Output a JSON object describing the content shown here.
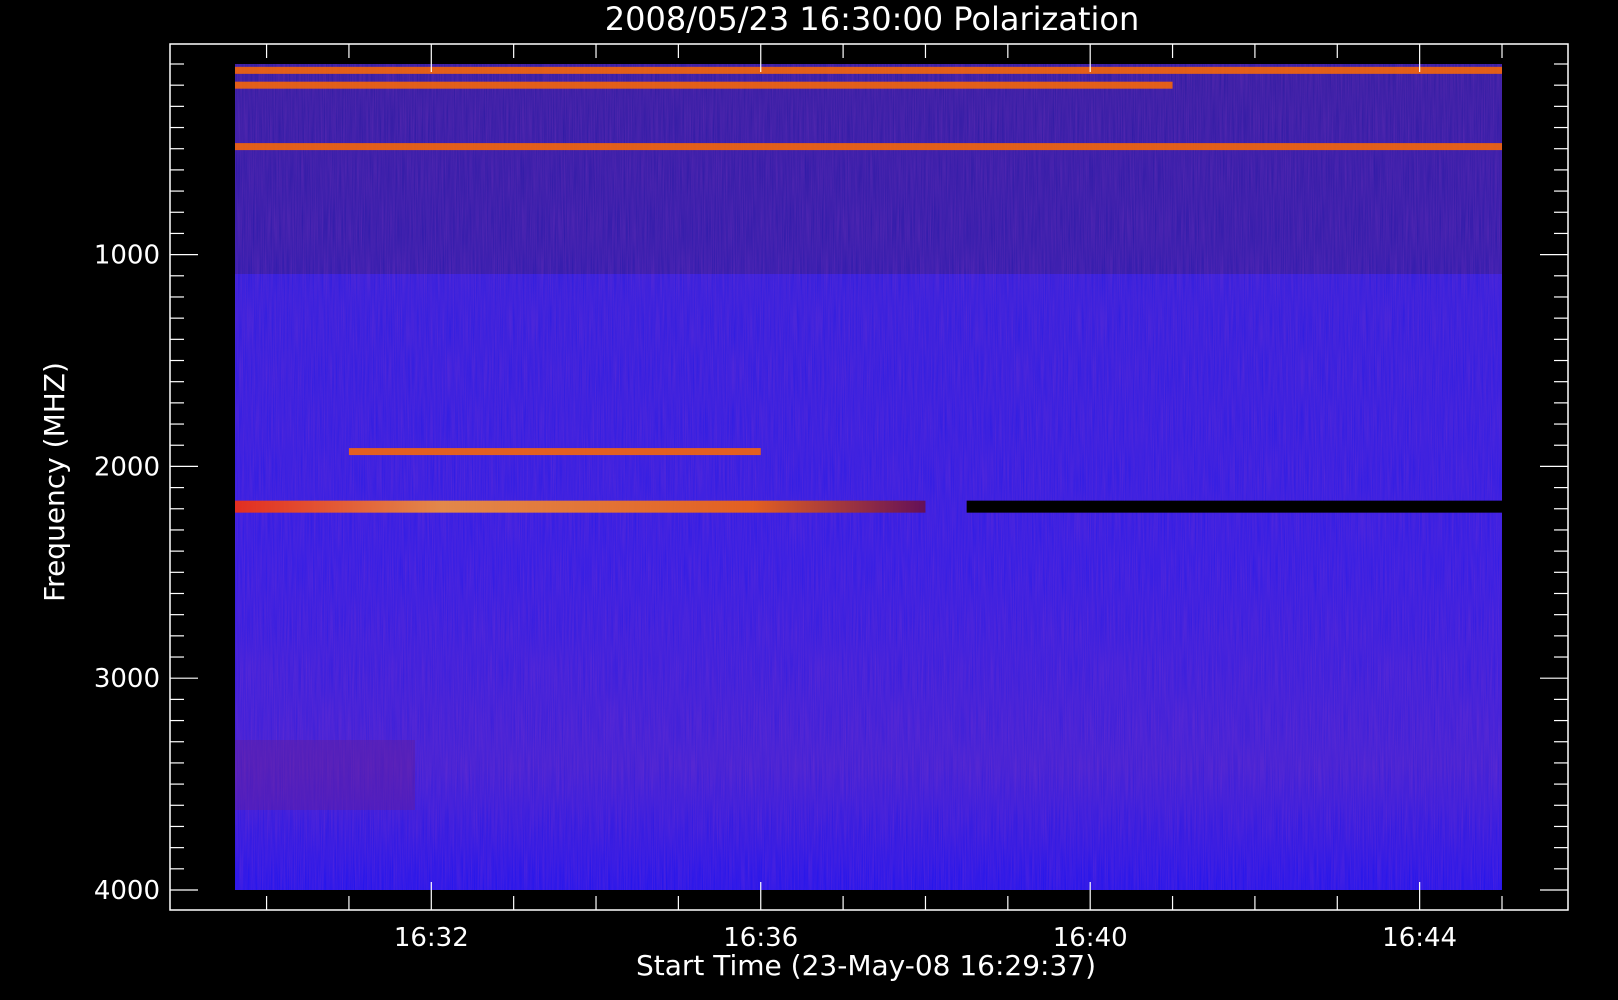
{
  "chart_data": {
    "type": "heatmap",
    "title": "2008/05/23 16:30:00 Polarization",
    "xlabel": "Start Time (23-May-08 16:29:37)",
    "ylabel": "Frequency (MHZ)",
    "x_ticks": [
      "16:32",
      "16:36",
      "16:40",
      "16:44"
    ],
    "y_ticks": [
      "1000",
      "2000",
      "3000",
      "4000"
    ],
    "xlim": [
      "16:29:37",
      "16:45:00"
    ],
    "ylim": [
      4000,
      100
    ],
    "y_inverted": true,
    "colors": {
      "background": "#000000",
      "field": "#2a1be6",
      "rfi_hot": "#ff6a00",
      "rfi_peak": "#ffb040",
      "rfi_cold": "#000000"
    },
    "features": [
      {
        "freq_mhz": 130,
        "t_start": "16:29:37",
        "t_end": "16:45:00",
        "intensity": "high"
      },
      {
        "freq_mhz": 200,
        "t_start": "16:29:37",
        "t_end": "16:41:00",
        "intensity": "high"
      },
      {
        "freq_mhz": 490,
        "t_start": "16:29:37",
        "t_end": "16:45:00",
        "intensity": "high"
      },
      {
        "freq_mhz": 1930,
        "t_start": "16:31:00",
        "t_end": "16:36:00",
        "intensity": "high"
      },
      {
        "freq_mhz": 2190,
        "t_start": "16:29:37",
        "t_end": "16:38:00",
        "intensity": "high"
      },
      {
        "freq_mhz": 2190,
        "t_start": "16:38:30",
        "t_end": "16:45:00",
        "intensity": "low"
      }
    ]
  }
}
